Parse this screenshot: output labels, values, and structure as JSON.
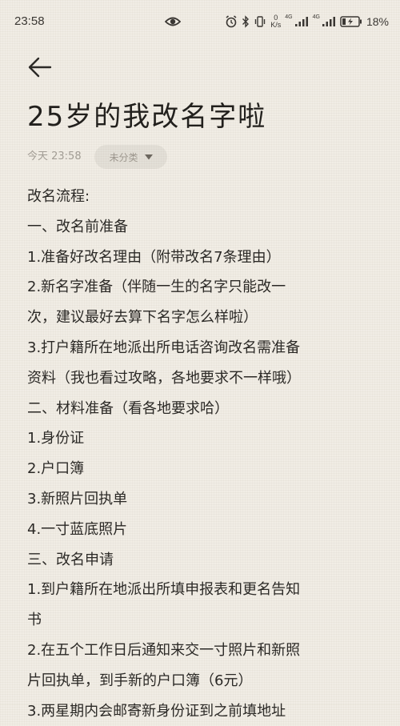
{
  "status_bar": {
    "time": "23:58",
    "net_speed_value": "0",
    "net_speed_unit": "K/s",
    "signal1_label": "4G",
    "signal2_label": "4G",
    "battery": "18%"
  },
  "note": {
    "title": "25岁的我改名字啦",
    "date": "今天 23:58",
    "category": "未分类",
    "lines": [
      "改名流程:",
      "一、改名前准备",
      "1.准备好改名理由（附带改名7条理由）",
      "2.新名字准备（伴随一生的名字只能改一",
      "次，建议最好去算下名字怎么样啦）",
      "3.打户籍所在地派出所电话咨询改名需准备",
      "资料（我也看过攻略，各地要求不一样哦）",
      "二、材料准备（看各地要求哈）",
      "1.身份证",
      "2.户口簿",
      "3.新照片回执单",
      "4.一寸蓝底照片",
      "三、改名申请",
      "1.到户籍所在地派出所填申报表和更名告知",
      "书",
      "2.在五个工作日后通知来交一寸照片和新照",
      "片回执单，到手新的户口簿（6元）",
      "3.两星期内会邮寄新身份证到之前填地址"
    ]
  }
}
